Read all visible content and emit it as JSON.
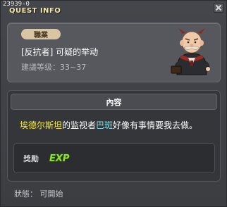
{
  "window": {
    "quest_id": "23939-0",
    "title": "QUEST INFO"
  },
  "quest": {
    "job_badge": "職業",
    "name": "[反抗者] 可疑的举动",
    "level_label": "建議等级：33~37",
    "npc_icon": "npc-portrait"
  },
  "content": {
    "header": "內容",
    "desc_part1": "埃德尔斯坦",
    "desc_part2": "的监视者",
    "desc_part3": "巴斑",
    "desc_part4": "好像有事情要我去做。"
  },
  "reward": {
    "label": "獎勵",
    "icon_text": "EXP"
  },
  "status": {
    "text": "狀態：  可開始"
  },
  "colors": {
    "highlight_place": "#f5ea4a",
    "highlight_npc": "#7fe7f1",
    "title": "#f3e8a6",
    "badge_bg": "#d9c5a2",
    "exp_green": "#8edf2f"
  }
}
